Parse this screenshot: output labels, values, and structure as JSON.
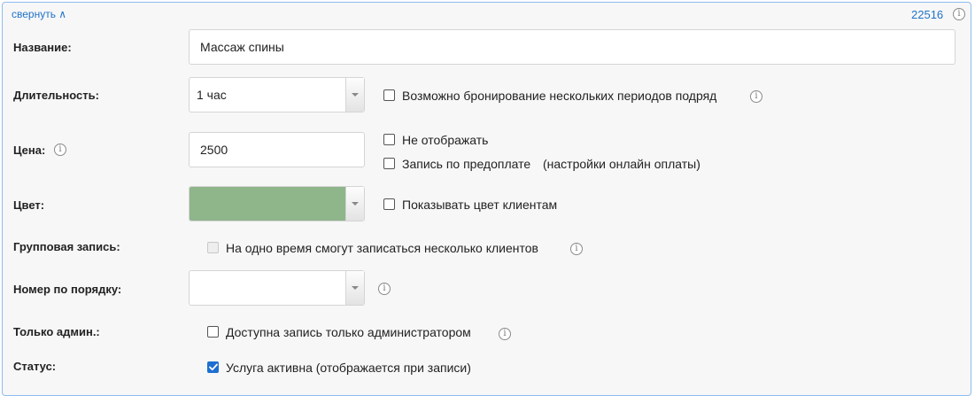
{
  "header": {
    "collapse_label": "свернуть ∧",
    "service_id": "22516"
  },
  "icons": {
    "info": "info-icon",
    "info_glyph": "i",
    "dropdown": "chevron-down-icon",
    "check": "checkmark-icon"
  },
  "form": {
    "name": {
      "label": "Название:",
      "value": "Массаж спины"
    },
    "duration": {
      "label": "Длительность:",
      "selected": "1 час",
      "multi_period_label": "Возможно бронирование нескольких периодов подряд",
      "multi_period_checked": false
    },
    "price": {
      "label": "Цена:",
      "value": "2500",
      "hide_label": "Не отображать",
      "hide_checked": false,
      "prepay_label": "Запись по предоплате",
      "prepay_link": "(настройки онлайн оплаты)",
      "prepay_checked": false
    },
    "color": {
      "label": "Цвет:",
      "selected_color": "#8fb58b",
      "show_to_clients_label": "Показывать цвет клиентам",
      "show_to_clients_checked": false
    },
    "group": {
      "label": "Групповая запись:",
      "option_label": "На одно время смогут записаться несколько клиентов",
      "option_checked": false,
      "option_disabled": true
    },
    "order": {
      "label": "Номер по порядку:",
      "selected": ""
    },
    "admin_only": {
      "label": "Только админ.:",
      "option_label": "Доступна запись только администратором",
      "option_checked": false
    },
    "status": {
      "label": "Статус:",
      "option_label": "Услуга активна (отображается при записи)",
      "option_checked": true
    }
  },
  "colors": {
    "accent_link": "#1f73c9",
    "panel_border": "#8ebcf0",
    "checkbox_checked": "#1e6fd0"
  }
}
